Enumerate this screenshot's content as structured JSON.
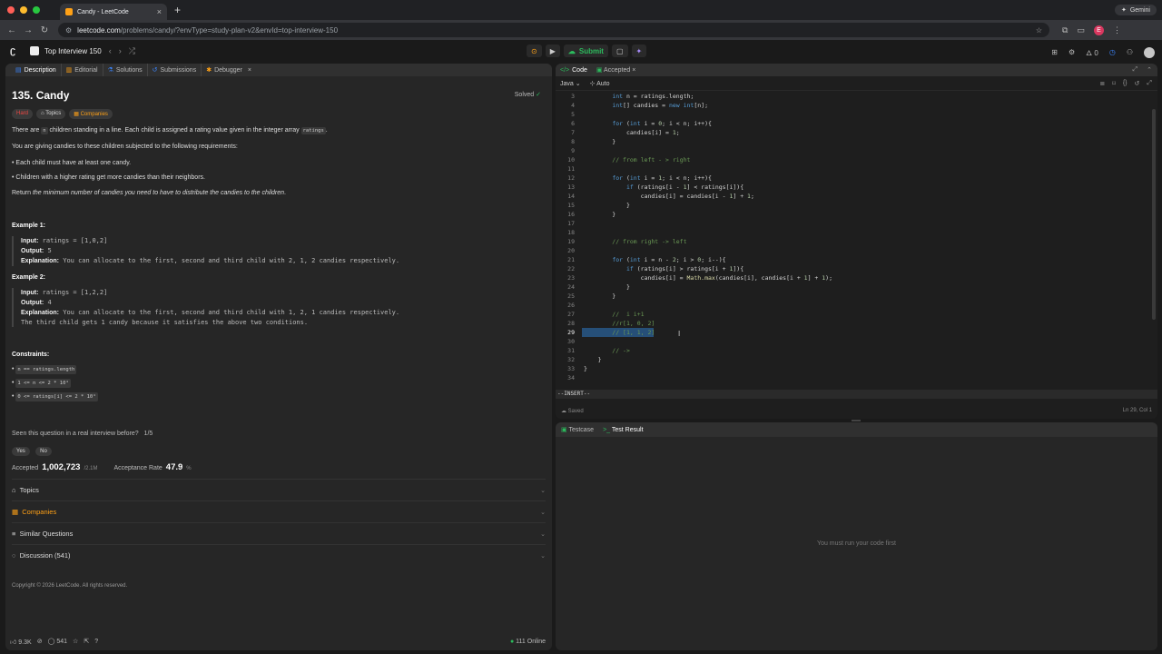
{
  "browser": {
    "tab_title": "Candy - LeetCode",
    "url_host": "leetcode.com",
    "url_path": "/problems/candy/?envType=study-plan-v2&envId=top-interview-150",
    "gemini": "Gemini",
    "profile_initial": "E"
  },
  "header": {
    "study_plan": "Top Interview 150",
    "submit": "Submit"
  },
  "left_tabs": [
    {
      "label": "Description"
    },
    {
      "label": "Editorial"
    },
    {
      "label": "Solutions"
    },
    {
      "label": "Submissions"
    },
    {
      "label": "Debugger"
    }
  ],
  "problem": {
    "title": "135. Candy",
    "status": "Solved",
    "difficulty": "Hard",
    "tag_topics": "Topics",
    "tag_companies": "Companies",
    "desc1_a": "There are ",
    "desc1_n": "n",
    "desc1_b": " children standing in a line. Each child is assigned a rating value given in the integer array ",
    "desc1_c": "ratings",
    "desc1_d": ".",
    "desc2": "You are giving candies to these children subjected to the following requirements:",
    "req1": "Each child must have at least one candy.",
    "req2": "Children with a higher rating get more candies than their neighbors.",
    "desc3_a": "Return ",
    "desc3_b": "the minimum number of candies you need to have to distribute the candies to the children",
    "desc3_c": ".",
    "ex1_title": "Example 1:",
    "ex1_input_label": "Input:",
    "ex1_input": "ratings = [1,0,2]",
    "ex1_output_label": "Output:",
    "ex1_output": "5",
    "ex1_expl_label": "Explanation:",
    "ex1_expl": "You can allocate to the first, second and third child with 2, 1, 2 candies respectively.",
    "ex2_title": "Example 2:",
    "ex2_input_label": "Input:",
    "ex2_input": "ratings = [1,2,2]",
    "ex2_output_label": "Output:",
    "ex2_output": "4",
    "ex2_expl_label": "Explanation:",
    "ex2_expl": "You can allocate to the first, second and third child with 1, 2, 1 candies respectively.",
    "ex2_expl2": "The third child gets 1 candy because it satisfies the above two conditions.",
    "constraints_title": "Constraints:",
    "c1": "n == ratings.length",
    "c2": "1 <= n <= 2 * 10⁴",
    "c3": "0 <= ratings[i] <= 2 * 10⁴",
    "seen_q": "Seen this question in a real interview before?",
    "seen_count": "1/5",
    "yes": "Yes",
    "no": "No",
    "accepted_label": "Accepted",
    "accepted_val": "1,002,723",
    "accepted_total": "/2.1M",
    "rate_label": "Acceptance Rate",
    "rate_val": "47.9",
    "rate_unit": "%",
    "acc_topics": "Topics",
    "acc_companies": "Companies",
    "acc_similar": "Similar Questions",
    "acc_discussion": "Discussion (541)",
    "copyright": "Copyright © 2026 LeetCode. All rights reserved."
  },
  "footer": {
    "likes": "9.3K",
    "comments": "541",
    "online": "111 Online"
  },
  "code_panel": {
    "tab_code": "Code",
    "tab_accepted": "Accepted",
    "lang": "Java",
    "auto": "Auto",
    "mode": "--INSERT--",
    "saved": "Saved",
    "cursor": "Ln 29, Col 1"
  },
  "code_lines": [
    {
      "n": "3",
      "t": "        int n = ratings.length;"
    },
    {
      "n": "4",
      "t": "        int[] candies = new int[n];"
    },
    {
      "n": "5",
      "t": ""
    },
    {
      "n": "6",
      "t": "        for (int i = 0; i < n; i++){"
    },
    {
      "n": "7",
      "t": "            candies[i] = 1;"
    },
    {
      "n": "8",
      "t": "        }"
    },
    {
      "n": "9",
      "t": ""
    },
    {
      "n": "10",
      "t": "        // from left - > right"
    },
    {
      "n": "11",
      "t": ""
    },
    {
      "n": "12",
      "t": "        for (int i = 1; i < n; i++){"
    },
    {
      "n": "13",
      "t": "            if (ratings[i - 1] < ratings[i]){"
    },
    {
      "n": "14",
      "t": "                candies[i] = candies[i - 1] + 1;"
    },
    {
      "n": "15",
      "t": "            }"
    },
    {
      "n": "16",
      "t": "        }"
    },
    {
      "n": "17",
      "t": ""
    },
    {
      "n": "18",
      "t": ""
    },
    {
      "n": "19",
      "t": "        // from right -> left"
    },
    {
      "n": "20",
      "t": ""
    },
    {
      "n": "21",
      "t": "        for (int i = n - 2; i > 0; i--){"
    },
    {
      "n": "22",
      "t": "            if (ratings[i] > ratings[i + 1]){"
    },
    {
      "n": "23",
      "t": "                candies[i] = Math.max(candies[i], candies[i + 1] + 1);"
    },
    {
      "n": "24",
      "t": "            }"
    },
    {
      "n": "25",
      "t": "        }"
    },
    {
      "n": "26",
      "t": ""
    },
    {
      "n": "27",
      "t": "        //  i i+1"
    },
    {
      "n": "28",
      "t": "        //r[1, 0, 2]"
    },
    {
      "n": "29",
      "t": "        // [1, 1, 2]"
    },
    {
      "n": "30",
      "t": ""
    },
    {
      "n": "31",
      "t": "        // ->"
    },
    {
      "n": "32",
      "t": "    }"
    },
    {
      "n": "33",
      "t": "}"
    },
    {
      "n": "34",
      "t": ""
    }
  ],
  "result_panel": {
    "tab_testcase": "Testcase",
    "tab_result": "Test Result",
    "empty_msg": "You must run your code first"
  }
}
